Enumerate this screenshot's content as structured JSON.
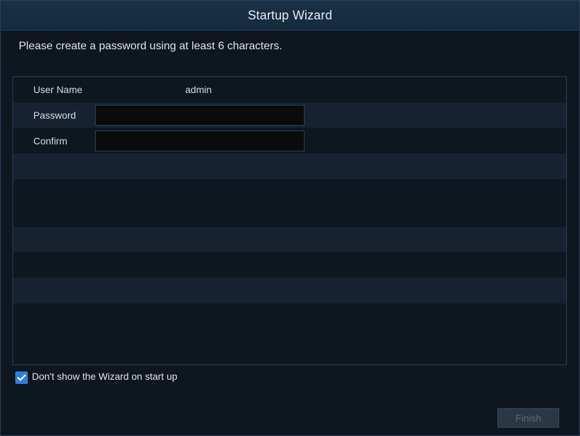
{
  "window": {
    "title": "Startup Wizard"
  },
  "instruction": "Please create a password using at least 6 characters.",
  "form": {
    "username": {
      "label": "User Name",
      "value": "admin"
    },
    "password": {
      "label": "Password",
      "value": ""
    },
    "confirm": {
      "label": "Confirm",
      "value": ""
    }
  },
  "options": {
    "dont_show_label": "Don't show the Wizard on start up",
    "dont_show_checked": true
  },
  "buttons": {
    "finish_label": "Finish",
    "finish_enabled": false
  },
  "colors": {
    "background": "#0e1620",
    "titlebar": "#173047",
    "accent": "#2f7fd6"
  },
  "icons": {
    "checkbox": "check-icon"
  }
}
